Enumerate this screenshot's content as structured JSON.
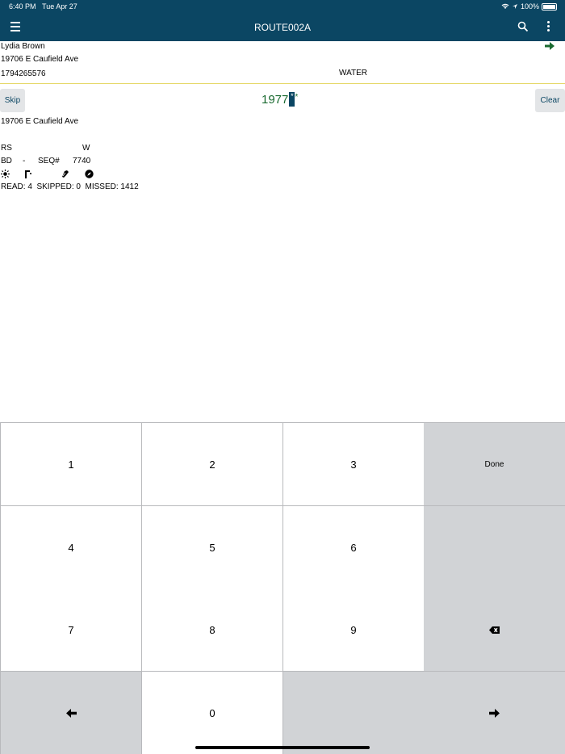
{
  "status_bar": {
    "time": "6:40 PM",
    "date": "Tue Apr 27",
    "battery": "100%"
  },
  "navbar": {
    "title": "ROUTE002A",
    "menu_icon": "hamburger-icon",
    "search_icon": "search-icon",
    "more_icon": "kebab-icon"
  },
  "customer": {
    "name": "Lydia Brown",
    "address": "19706 E Caufield Ave",
    "account": "1794265576",
    "service": "WATER"
  },
  "actions": {
    "skip_label": "Skip",
    "clear_label": "Clear"
  },
  "reading": {
    "value": "1977",
    "cursor_char": "*",
    "suffix": "*"
  },
  "meter": {
    "address": "19706 E Caufield Ave",
    "rs_label": "RS",
    "service_code": "W",
    "bd_label": "BD",
    "bd_value": "-",
    "seq_label": "SEQ#",
    "seq_value": "7740",
    "icons": [
      "sun-icon",
      "key-icon",
      "dog-icon",
      "compass-icon"
    ]
  },
  "stats": {
    "read_label": "READ:",
    "read": "4",
    "skipped_label": "SKIPPED:",
    "skipped": "0",
    "missed_label": "MISSED:",
    "missed": "1412"
  },
  "keypad": {
    "k1": "1",
    "k2": "2",
    "k3": "3",
    "done": "Done",
    "k4": "4",
    "k5": "5",
    "k6": "6",
    "k7": "7",
    "k8": "8",
    "k9": "9",
    "backspace_icon": "backspace-icon",
    "k0": "0",
    "prev_icon": "arrow-left-icon",
    "next_icon": "arrow-right-icon"
  },
  "colors": {
    "header": "#0b4663",
    "reading_green": "#1a6a30",
    "key_gray": "#d1d3d6",
    "button_gray": "#e3e5e7"
  }
}
